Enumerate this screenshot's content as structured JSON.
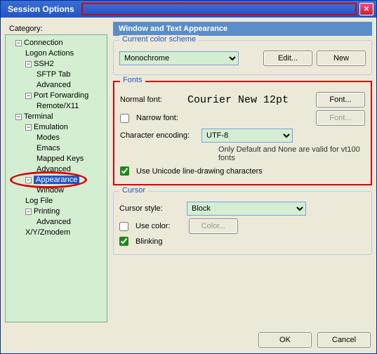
{
  "title": "Session Options",
  "category_label": "Category:",
  "tree": {
    "connection": "Connection",
    "logon_actions": "Logon Actions",
    "ssh2": "SSH2",
    "sftp_tab": "SFTP Tab",
    "ssh2_advanced": "Advanced",
    "port_fwd": "Port Forwarding",
    "remote_x11": "Remote/X11",
    "terminal": "Terminal",
    "emulation": "Emulation",
    "modes": "Modes",
    "emacs": "Emacs",
    "mapped_keys": "Mapped Keys",
    "em_advanced": "Advanced",
    "appearance": "Appearance",
    "window": "Window",
    "log_file": "Log File",
    "printing": "Printing",
    "pr_advanced": "Advanced",
    "xy_zmodem": "X/Y/Zmodem"
  },
  "panel_title": "Window and Text Appearance",
  "color_scheme": {
    "legend": "Current color scheme",
    "value": "Monochrome",
    "edit": "Edit...",
    "new": "New"
  },
  "fonts": {
    "legend": "Fonts",
    "normal_label": "Normal font:",
    "sample": "Courier New 12pt",
    "font_btn": "Font...",
    "narrow_label": "Narrow font:",
    "narrow_font_btn": "Font...",
    "encoding_label": "Character encoding:",
    "encoding_value": "UTF-8",
    "encoding_note": "Only Default and None are valid for vt100 fonts",
    "unicode_label": "Use Unicode line-drawing characters"
  },
  "cursor": {
    "legend": "Cursor",
    "style_label": "Cursor style:",
    "style_value": "Block",
    "use_color_label": "Use color:",
    "color_btn": "Color...",
    "blinking_label": "Blinking"
  },
  "footer": {
    "ok": "OK",
    "cancel": "Cancel"
  }
}
